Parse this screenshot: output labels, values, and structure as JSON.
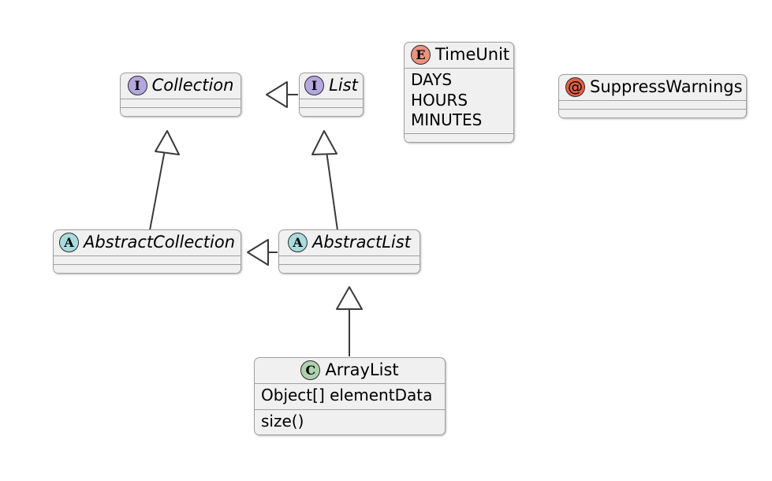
{
  "diagram": {
    "kind": "uml-class-diagram",
    "background": "#ffffff",
    "palette": {
      "node_fill": "#f0f0f0",
      "node_border": "#a0a0a0",
      "line": "#3a3a3a",
      "interface_badge": "#b4a7e0",
      "abstract_badge": "#a8dcdc",
      "class_badge": "#add1ad",
      "enum_badge": "#eb937f",
      "annotation_badge": "#e4613e"
    },
    "nodes": {
      "collection": {
        "name": "Collection",
        "stereotype_glyph": "I",
        "stereotype_kind": "interface"
      },
      "list": {
        "name": "List",
        "stereotype_glyph": "I",
        "stereotype_kind": "interface"
      },
      "time_unit": {
        "name": "TimeUnit",
        "stereotype_glyph": "E",
        "stereotype_kind": "enumeration",
        "constants": [
          "DAYS",
          "HOURS",
          "MINUTES"
        ]
      },
      "suppress_warnings": {
        "name": "SuppressWarnings",
        "stereotype_glyph": "@",
        "stereotype_kind": "annotation"
      },
      "abstract_collection": {
        "name": "AbstractCollection",
        "stereotype_glyph": "A",
        "stereotype_kind": "abstract"
      },
      "abstract_list": {
        "name": "AbstractList",
        "stereotype_glyph": "A",
        "stereotype_kind": "abstract"
      },
      "array_list": {
        "name": "ArrayList",
        "stereotype_glyph": "C",
        "stereotype_kind": "class",
        "fields": [
          "Object[] elementData"
        ],
        "methods": [
          "size()"
        ]
      }
    },
    "relationships": [
      {
        "from": "List",
        "to": "Collection",
        "type": "generalization"
      },
      {
        "from": "AbstractCollection",
        "to": "Collection",
        "type": "generalization"
      },
      {
        "from": "AbstractList",
        "to": "List",
        "type": "generalization"
      },
      {
        "from": "AbstractList",
        "to": "AbstractCollection",
        "type": "generalization"
      },
      {
        "from": "ArrayList",
        "to": "AbstractList",
        "type": "generalization"
      }
    ]
  }
}
